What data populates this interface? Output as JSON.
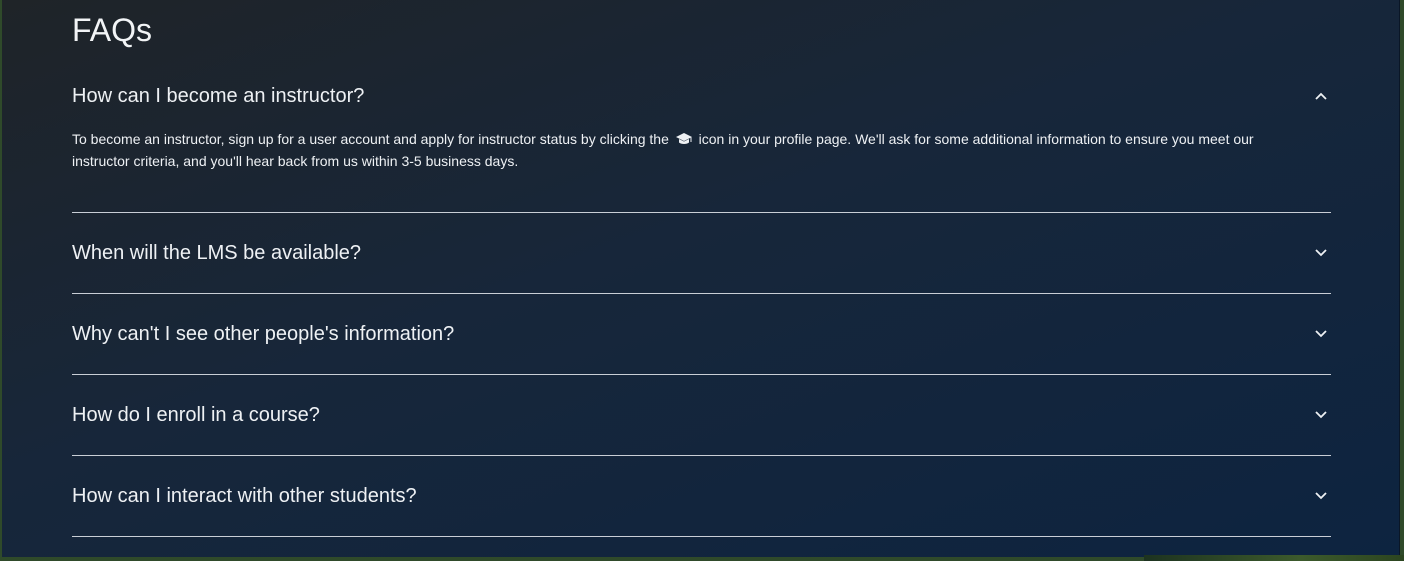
{
  "faq": {
    "title": "FAQs",
    "items": [
      {
        "question": "How can I become an instructor?",
        "expanded": true,
        "answer_before_icon": "To become an instructor, sign up for a user account and apply for instructor status by clicking the",
        "answer_icon": "graduation-cap-icon",
        "answer_after_icon": "icon in your profile page. We'll ask for some additional information to ensure you meet our instructor criteria, and you'll hear back from us within 3-5 business days."
      },
      {
        "question": "When will the LMS be available?",
        "expanded": false
      },
      {
        "question": "Why can't I see other people's information?",
        "expanded": false
      },
      {
        "question": "How do I enroll in a course?",
        "expanded": false
      },
      {
        "question": "How can I interact with other students?",
        "expanded": false
      }
    ]
  },
  "colors": {
    "text": "#eef1f4",
    "divider": "#c9ced6",
    "background": "#17263a"
  }
}
